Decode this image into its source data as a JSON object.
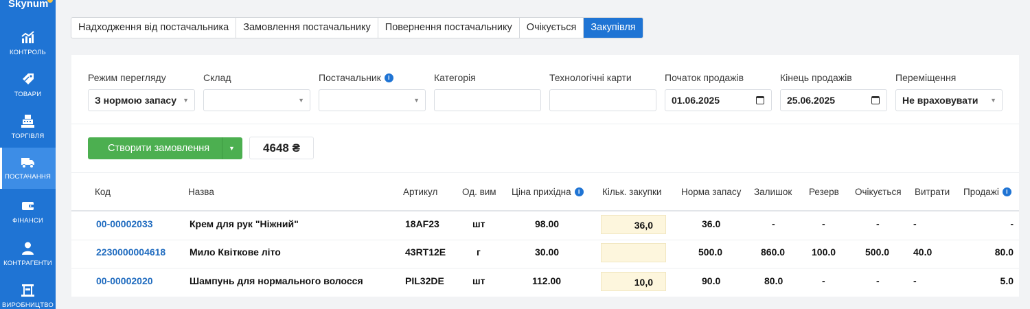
{
  "app": {
    "logo": "Skynum"
  },
  "sidebar": {
    "items": [
      {
        "label": "КОНТРОЛЬ",
        "icon": "chart-icon"
      },
      {
        "label": "ТОВАРИ",
        "icon": "tag-icon"
      },
      {
        "label": "ТОРГІВЛЯ",
        "icon": "cash-register-icon"
      },
      {
        "label": "ПОСТАЧАННЯ",
        "icon": "truck-icon",
        "active": true
      },
      {
        "label": "ФІНАНСИ",
        "icon": "wallet-icon"
      },
      {
        "label": "КОНТРАГЕНТИ",
        "icon": "person-icon"
      },
      {
        "label": "ВИРОБНИЦТВО",
        "icon": "factory-icon"
      }
    ]
  },
  "tabs": [
    {
      "label": "Надходження від постачальника"
    },
    {
      "label": "Замовлення постачальнику"
    },
    {
      "label": "Повернення постачальнику"
    },
    {
      "label": "Очікується"
    },
    {
      "label": "Закупівля",
      "active": true
    }
  ],
  "filters": {
    "view_mode": {
      "label": "Режим перегляду",
      "value": "З нормою запасу"
    },
    "warehouse": {
      "label": "Склад",
      "value": ""
    },
    "supplier": {
      "label": "Постачальник",
      "value": ""
    },
    "category": {
      "label": "Категорія",
      "value": ""
    },
    "tech_cards": {
      "label": "Технологічні карти",
      "value": ""
    },
    "sales_start": {
      "label": "Початок продажів",
      "value": "01.06.2025"
    },
    "sales_end": {
      "label": "Кінець продажів",
      "value": "25.06.2025"
    },
    "transfers": {
      "label": "Переміщення",
      "value": "Не враховувати"
    }
  },
  "actions": {
    "create_order": "Створити замовлення",
    "total": "4648 ₴"
  },
  "table": {
    "columns": {
      "code": "Код",
      "name": "Назва",
      "sku": "Артикул",
      "unit": "Од. вим",
      "price": "Ціна прихідна",
      "qty": "Кільк. закупки",
      "norm": "Норма запасу",
      "stock": "Залишок",
      "reserve": "Резерв",
      "expected": "Очікується",
      "expenses": "Витрати",
      "sales": "Продажі"
    },
    "rows": [
      {
        "code": "00-00002033",
        "name": "Крем для рук \"Ніжний\"",
        "sku": "18AF23",
        "unit": "шт",
        "price": "98.00",
        "qty": "36,0",
        "norm": "36.0",
        "stock": "-",
        "reserve": "-",
        "expected": "-",
        "expenses": "-",
        "sales": "-"
      },
      {
        "code": "2230000004618",
        "name": "Мило Квіткове літо",
        "sku": "43RT12E",
        "unit": "г",
        "price": "30.00",
        "qty": "",
        "norm": "500.0",
        "stock": "860.0",
        "reserve": "100.0",
        "expected": "500.0",
        "expenses": "40.0",
        "sales": "80.0"
      },
      {
        "code": "00-00002020",
        "name": "Шампунь для нормального волосся",
        "sku": "PIL32DE",
        "unit": "шт",
        "price": "112.00",
        "qty": "10,0",
        "norm": "90.0",
        "stock": "80.0",
        "reserve": "-",
        "expected": "-",
        "expenses": "-",
        "sales": "5.0"
      }
    ]
  }
}
